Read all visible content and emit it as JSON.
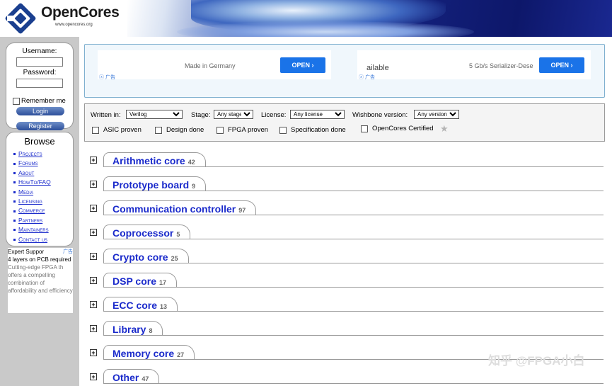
{
  "header": {
    "logo_text": "OpenCores",
    "logo_sub": "www.opencores.org"
  },
  "login": {
    "username_label": "Username:",
    "password_label": "Password:",
    "remember_label": "Remember me",
    "login_button": "Login",
    "register_button": "Register"
  },
  "browse": {
    "title": "Browse",
    "items": [
      "Projects",
      "Forums",
      "About",
      "HowTo/FAQ",
      "Media",
      "Licensing",
      "Commerce",
      "Partners",
      "Maintainers",
      "Contact us"
    ]
  },
  "left_ad": {
    "tag": "广告",
    "line1": "Expert Suppor",
    "line2": "4 layers on PCB required",
    "line3": "Cutting-edge FPGA th offers a compelling combination of affordability and efficiency"
  },
  "top_ads": [
    {
      "text": "Made in Germany",
      "open": "OPEN ›",
      "tag": "ⓧ 广告"
    },
    {
      "text": "ailable",
      "text2": "5 Gb/s Serializer-Dese",
      "open": "OPEN ›",
      "tag": "ⓧ 广告"
    }
  ],
  "filters": {
    "written_in_label": "Written in:",
    "written_in_value": "Verilog",
    "stage_label": "Stage:",
    "stage_value": "Any stage",
    "license_label": "License:",
    "license_value": "Any license",
    "wishbone_label": "Wishbone version:",
    "wishbone_value": "Any version",
    "checks": [
      "ASIC proven",
      "Design done",
      "FPGA proven",
      "Specification done",
      "OpenCores Certified"
    ]
  },
  "categories": [
    {
      "name": "Arithmetic core",
      "count": "42"
    },
    {
      "name": "Prototype board",
      "count": "9"
    },
    {
      "name": "Communication controller",
      "count": "97"
    },
    {
      "name": "Coprocessor",
      "count": "5"
    },
    {
      "name": "Crypto core",
      "count": "25"
    },
    {
      "name": "DSP core",
      "count": "17"
    },
    {
      "name": "ECC core",
      "count": "13"
    },
    {
      "name": "Library",
      "count": "8"
    },
    {
      "name": "Memory core",
      "count": "27"
    },
    {
      "name": "Other",
      "count": "47"
    }
  ],
  "watermark": "知乎 @FPGA小白",
  "colors": {
    "link": "#1a2acb",
    "accent": "#1a73e8"
  }
}
